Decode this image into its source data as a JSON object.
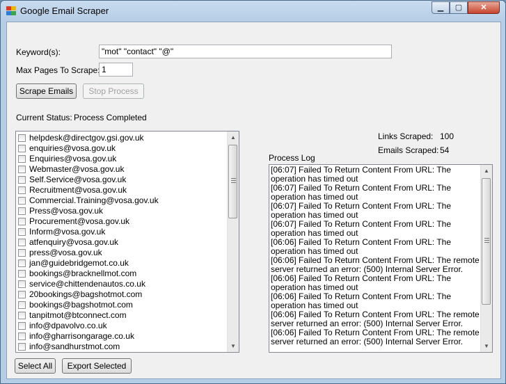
{
  "window": {
    "title": "Google Email Scraper",
    "min_glyph": "▁",
    "max_glyph": "▢",
    "close_glyph": "✕"
  },
  "form": {
    "keywords_label": "Keyword(s):",
    "keywords_value": "\"mot\" \"contact\" \"@\"",
    "max_pages_label": "Max Pages To Scrape:",
    "max_pages_value": "1",
    "scrape_button": "Scrape Emails",
    "stop_button": "Stop Process",
    "status_label": "Current Status:",
    "status_value": "Process Completed"
  },
  "emails": [
    "helpdesk@directgov.gsi.gov.uk",
    "enquiries@vosa.gov.uk",
    "Enquiries@vosa.gov.uk",
    "Webmaster@vosa.gov.uk",
    "Self.Service@vosa.gov.uk",
    "Recruitment@vosa.gov.uk",
    "Commercial.Training@vosa.gov.uk",
    "Press@vosa.gov.uk",
    "Procurement@vosa.gov.uk",
    "Inform@vosa.gov.uk",
    "atfenquiry@vosa.gov.uk",
    "press@vosa.gov.uk",
    "jan@guidebridgemot.co.uk",
    "bookings@bracknellmot.com",
    "service@chittendenautos.co.uk",
    "20bookings@bagshotmot.com",
    "bookings@bagshotmot.com",
    "tanpitmot@btconnect.com",
    "info@dpavolvo.co.uk",
    "info@gharrisongarage.co.uk",
    "info@sandhurstmot.com"
  ],
  "stats": {
    "links_label": "Links Scraped:",
    "links_value": "100",
    "emails_label": "Emails Scraped:",
    "emails_value": "54"
  },
  "log": {
    "label": "Process Log",
    "entries": [
      "[06:07] Failed To Return Content From URL: The operation has timed out",
      "[06:07] Failed To Return Content From URL: The operation has timed out",
      "[06:07] Failed To Return Content From URL: The operation has timed out",
      "[06:07] Failed To Return Content From URL: The operation has timed out",
      "[06:06] Failed To Return Content From URL: The operation has timed out",
      "[06:06] Failed To Return Content From URL: The remote server returned an error: (500) Internal Server Error.",
      "[06:06] Failed To Return Content From URL: The operation has timed out",
      "[06:06] Failed To Return Content From URL: The operation has timed out",
      "[06:06] Failed To Return Content From URL: The remote server returned an error: (500) Internal Server Error.",
      "[06:06] Failed To Return Content From URL: The remote server returned an error: (500) Internal Server Error."
    ]
  },
  "actions": {
    "select_all": "Select All",
    "export_selected": "Export Selected"
  },
  "icons": {
    "window_icon": "app-icon",
    "scroll_up": "▲",
    "scroll_down": "▼"
  }
}
